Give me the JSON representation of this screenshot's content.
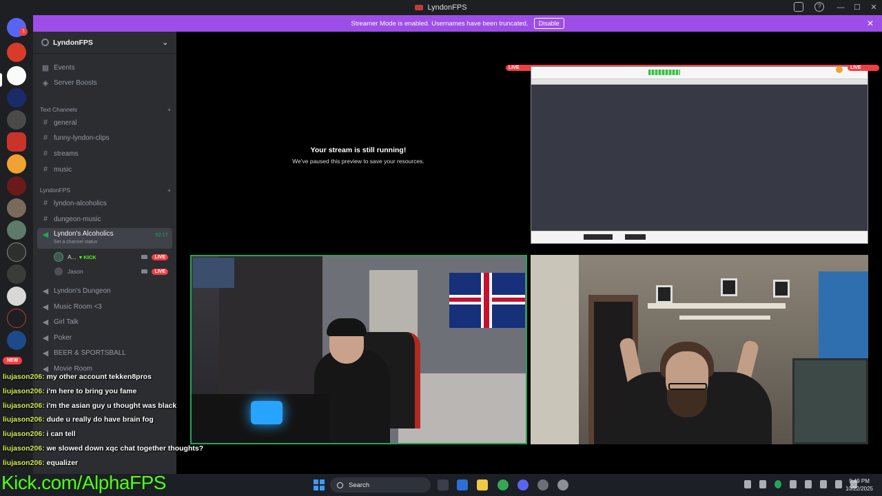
{
  "window": {
    "title": "LyndonFPS"
  },
  "banner": {
    "text": "Streamer Mode is enabled. Usernames have been truncated.",
    "disable_label": "Disable"
  },
  "rail": {
    "notification_badge": "1",
    "new_badge": "NEW"
  },
  "server": {
    "name": "LyndonFPS"
  },
  "sidebar": {
    "top_items": [
      {
        "label": "Events",
        "icon": "calendar-icon"
      },
      {
        "label": "Server Boosts",
        "icon": "boost-icon"
      }
    ],
    "category_text": "Text Channels",
    "text_channels": [
      "general",
      "funny-lyndon-clips",
      "streams",
      "music"
    ],
    "category_lyndonfps": "LyndonFPS",
    "lyndonfps_channels": [
      "lyndon-alcoholics",
      "dungeon-music"
    ],
    "active_voice": {
      "label": "Lyndon's Alcoholics",
      "status": "Set a channel status",
      "time": "52:17",
      "users": [
        {
          "name": "A...",
          "badge": "KICK",
          "live": "LIVE"
        },
        {
          "name": "Jason",
          "live": "LIVE"
        }
      ]
    },
    "voice_channels": [
      "Lyndon's Dungeon",
      "Music Room <3",
      "Girl Talk",
      "Poker",
      "BEER & SPORTSBALL",
      "Movie Room"
    ]
  },
  "stage": {
    "paused_title": "Your stream is still running!",
    "paused_subtitle": "We've paused this preview to save your resources.",
    "live_label": "LIVE"
  },
  "chat": [
    {
      "user": "liujason206:",
      "msg": "my other account tekken8pros"
    },
    {
      "user": "liujason206:",
      "msg": "i'm here to bring you fame"
    },
    {
      "user": "liujason206:",
      "msg": "i'm the asian guy u thought was black"
    },
    {
      "user": "liujason206:",
      "msg": "dude u really do have brain fog"
    },
    {
      "user": "liujason206:",
      "msg": "i can tell"
    },
    {
      "user": "liujason206:",
      "msg": "we slowed down xqc chat together thoughts?"
    },
    {
      "user": "liujason206:",
      "msg": "equalizer"
    }
  ],
  "overlay": {
    "brand": "Kick.com/AlphaFPS"
  },
  "taskbar": {
    "search_placeholder": "Search",
    "time": "9:49 PM",
    "date": "10/22/2025"
  },
  "colors": {
    "accent": "#9d4ee8",
    "live": "#f23f43",
    "kick_green": "#53fc18",
    "speaking": "#23a55a"
  }
}
